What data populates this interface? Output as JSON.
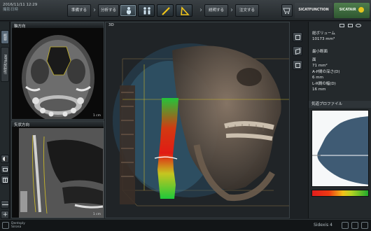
{
  "header": {
    "date": "2016/11/11 12:29",
    "subtitle": "撮影日時",
    "workflow": [
      "準備する",
      "分析する",
      "説明する",
      "注文する"
    ],
    "brand_function": "SICATFUNCTION",
    "brand_air": "SICATAIR"
  },
  "left_tabs": [
    "概要",
    "MPR/放射性"
  ],
  "panels": {
    "axial_title": "軸方向",
    "axial_scale": "1 cm",
    "sagittal_title": "矢状方向",
    "sagittal_scale": "1 cm",
    "main_title": "3D"
  },
  "info": {
    "total_volume_label": "総ボリューム",
    "total_volume_value": "10173 mm³",
    "min_section_label": "最小断面",
    "area_label": "面",
    "area_value": "71 mm²",
    "ap_label": "A-P間の深さ(D)",
    "ap_value": "6 mm",
    "lr_label": "L-R間の幅(D)",
    "lr_value": "16 mm",
    "profile_title": "気道プロファイル"
  },
  "footer": {
    "brand_left_1": "Dentsply",
    "brand_left_2": "Sirona",
    "brand_right": "Sidexis 4"
  },
  "colors": {
    "accent_air": "#3f6d3e",
    "heat_red": "#e21d1d",
    "heat_yellow": "#f2c21a",
    "heat_green": "#1faa2c"
  }
}
